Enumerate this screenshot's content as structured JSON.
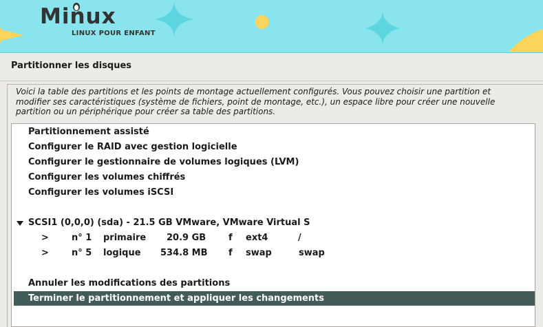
{
  "banner": {
    "logo_title": "Minux",
    "logo_subtitle": "LINUX POUR ENFANT"
  },
  "page": {
    "heading": "Partitionner les disques",
    "description": "Voici la table des partitions et les points de montage actuellement configurés. Vous pouvez choisir une partition et modifier ses caractéristiques (système de fichiers, point de montage, etc.), un espace libre pour créer une nouvelle partition ou un périphérique pour créer sa table des partitions."
  },
  "menu": {
    "guided": "Partitionnement assisté",
    "raid": "Configurer le RAID avec gestion logicielle",
    "lvm": "Configurer le gestionnaire de volumes logiques (LVM)",
    "encrypted": "Configurer les volumes chiffrés",
    "iscsi": "Configurer les volumes iSCSI"
  },
  "disk": {
    "label": "SCSI1 (0,0,0) (sda) - 21.5 GB VMware, VMware Virtual S",
    "partitions": [
      {
        "arrow": ">",
        "number": "n° 1",
        "type": "primaire",
        "size": "20.9 GB",
        "flag": "f",
        "fs": "ext4",
        "mount": "/"
      },
      {
        "arrow": ">",
        "number": "n° 5",
        "type": "logique",
        "size": "534.8 MB",
        "flag": "f",
        "fs": "swap",
        "mount": "swap"
      }
    ]
  },
  "actions": {
    "undo": "Annuler les modifications des partitions",
    "finish": "Terminer le partitionnement et appliquer les changements"
  },
  "colors": {
    "banner": "#8ae4ee",
    "selection": "#445c59",
    "star_yellow": "#fbd55b",
    "star_cyan": "#5ed6e0"
  },
  "icons": {
    "disk_expander": "triangle-down-icon"
  }
}
